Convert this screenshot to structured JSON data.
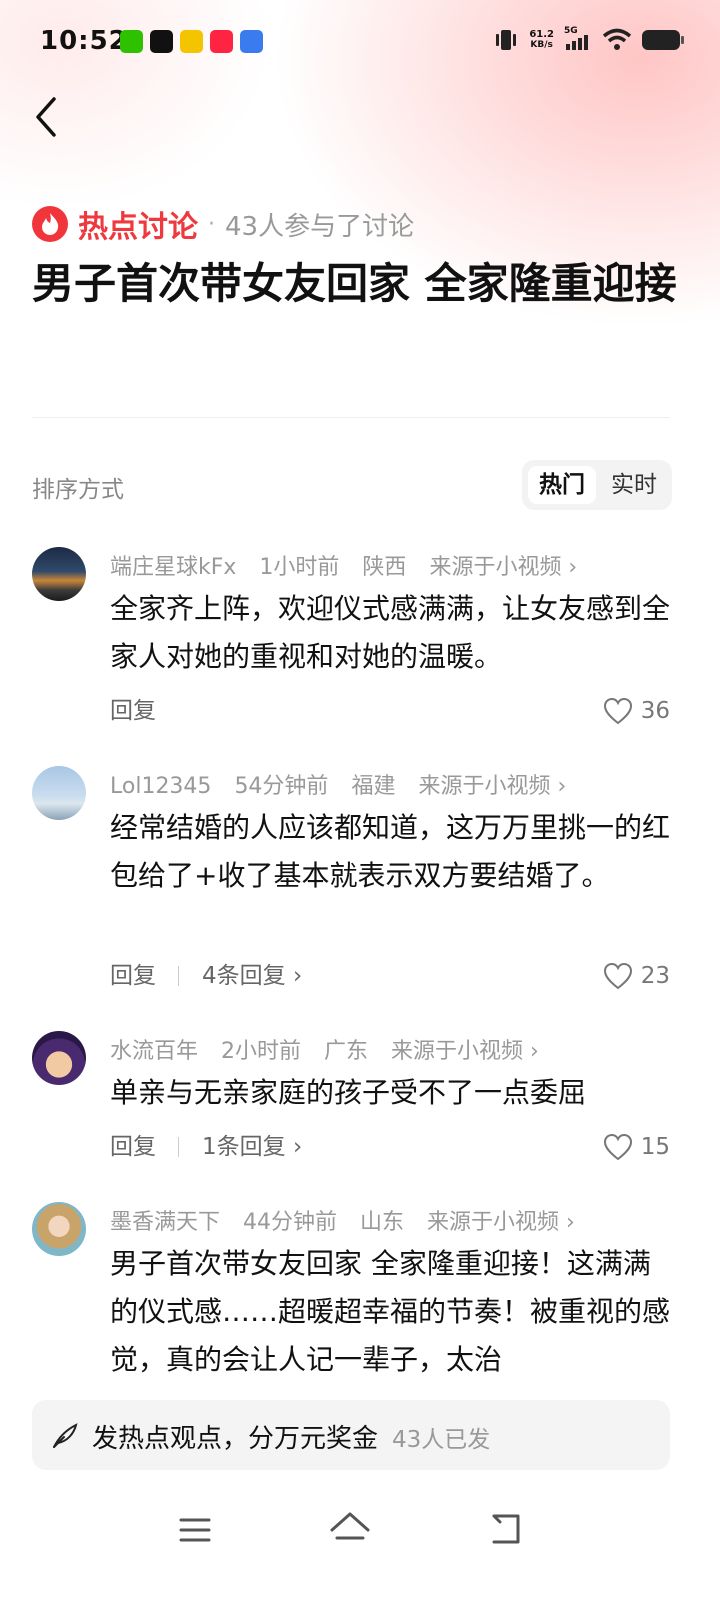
{
  "status_bar": {
    "time": "10:52",
    "network_speed_value": "61.2",
    "network_speed_unit": "KB/s",
    "signal_label": "5G"
  },
  "header": {
    "topic_label": "热点讨论",
    "separator": "·",
    "participants": "43人参与了讨论",
    "title": "男子首次带女友回家 全家隆重迎接"
  },
  "sort": {
    "label": "排序方式",
    "options": [
      "热门",
      "实时"
    ],
    "selected": "热门"
  },
  "comments": [
    {
      "user": "端庄星球kFx",
      "time": "1小时前",
      "location": "陕西",
      "source": "来源于小视频 ›",
      "text": "全家齐上阵，欢迎仪式感满满，让女友感到全家人对她的重视和对她的温暖。",
      "reply_label": "回复",
      "replies": "",
      "likes": "36"
    },
    {
      "user": "Lol12345",
      "time": "54分钟前",
      "location": "福建",
      "source": "来源于小视频 ›",
      "text": "经常结婚的人应该都知道，这万万里挑一的红包给了+收了基本就表示双方要结婚了。",
      "reply_label": "回复",
      "replies": "4条回复 ›",
      "likes": "23"
    },
    {
      "user": "水流百年",
      "time": "2小时前",
      "location": "广东",
      "source": "来源于小视频 ›",
      "text": "单亲与无亲家庭的孩子受不了一点委屈",
      "reply_label": "回复",
      "replies": "1条回复 ›",
      "likes": "15"
    },
    {
      "user": "墨香满天下",
      "time": "44分钟前",
      "location": "山东",
      "source": "来源于小视频 ›",
      "text": "男子首次带女友回家 全家隆重迎接！这满满的仪式感……超暖超幸福的节奏！被重视的感觉，真的会让人记一辈子，太治",
      "reply_label": "",
      "replies": "",
      "likes": ""
    }
  ],
  "post_bar": {
    "text": "发热点观点，分万元奖金",
    "count": "43人已发"
  },
  "colors": {
    "accent": "#ee3a3f",
    "muted": "#999999",
    "text": "#111111"
  },
  "icons": [
    "back-icon",
    "fire-icon",
    "heart-icon",
    "pen-icon",
    "menu-icon",
    "home-icon",
    "return-icon"
  ]
}
